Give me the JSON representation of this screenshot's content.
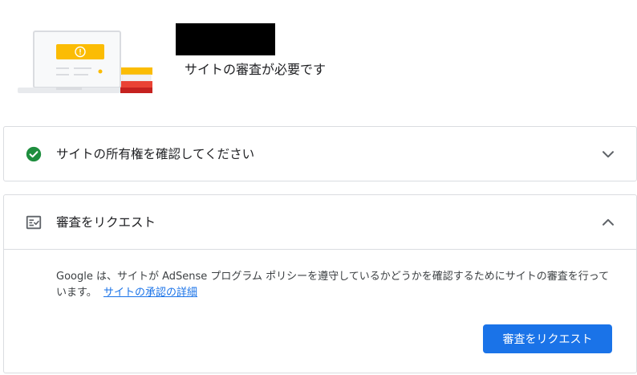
{
  "header": {
    "status_text": "サイトの審査が必要です",
    "site_name_redacted": true
  },
  "verify_card": {
    "title": "サイトの所有権を確認してください",
    "icon": "check-circle-icon",
    "chevron": "chevron-down-icon",
    "expanded": false
  },
  "review_card": {
    "title": "審査をリクエスト",
    "icon": "checklist-icon",
    "chevron": "chevron-up-icon",
    "expanded": true,
    "description": "Google は、サイトが AdSense プログラム ポリシーを遵守しているかどうかを確認するためにサイトの審査を行っています。",
    "link_text": "サイトの承認の詳細",
    "button_label": "審査をリクエスト"
  },
  "colors": {
    "accent": "#1a73e8",
    "success": "#1e8e3e",
    "border": "#dadce0",
    "text": "#202124",
    "warning_yellow": "#fbbc04"
  }
}
